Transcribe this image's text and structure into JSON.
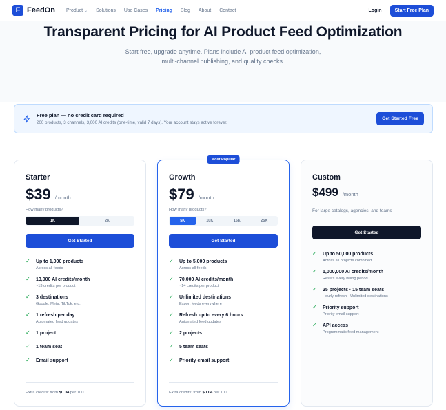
{
  "brand": {
    "name": "FeedOn",
    "mark": "F"
  },
  "nav": {
    "items": [
      {
        "label": "Product",
        "has_menu": true
      },
      {
        "label": "Solutions"
      },
      {
        "label": "Use Cases"
      },
      {
        "label": "Pricing",
        "active": true
      },
      {
        "label": "Blog"
      },
      {
        "label": "About"
      },
      {
        "label": "Contact"
      }
    ],
    "login_label": "Login",
    "cta_label": "Start Free Plan"
  },
  "hero": {
    "title": "Transparent Pricing for AI Product Feed Optimization",
    "subtitle_line1": "Start free, upgrade anytime. Plans include AI product feed optimization,",
    "subtitle_line2": "multi-channel publishing, and quality checks."
  },
  "free_banner": {
    "title": "Free plan — no credit card required",
    "subtitle": "200 products, 3 channels, 3,000 AI credits (one-time, valid 7 days). Your account stays active forever.",
    "button_label": "Get Started Free",
    "icon": "bolt-icon"
  },
  "plans": [
    {
      "name": "Starter",
      "price": "$39",
      "period": "/month",
      "qty_label": "How many products?",
      "options": [
        "1K",
        "2K"
      ],
      "selected": "1K",
      "cta": "Get Started",
      "features": [
        {
          "title": "Up to 1,000 products",
          "sub": "Across all feeds"
        },
        {
          "title": "13,000 AI credits/month",
          "sub": "~13 credits per product"
        },
        {
          "title": "3 destinations",
          "sub": "Google, Meta, TikTok, etc."
        },
        {
          "title": "1 refresh per day",
          "sub": "Automated feed updates"
        },
        {
          "title": "1 project",
          "sub": ""
        },
        {
          "title": "1 team seat",
          "sub": ""
        },
        {
          "title": "Email support",
          "sub": ""
        }
      ],
      "extra_prefix": "Extra credits: from",
      "extra_price": "$0.04",
      "extra_suffix": "per 100"
    },
    {
      "name": "Growth",
      "badge": "Most Popular",
      "price": "$79",
      "period": "/month",
      "qty_label": "How many products?",
      "options": [
        "5K",
        "10K",
        "15K",
        "25K"
      ],
      "selected": "5K",
      "cta": "Get Started",
      "features": [
        {
          "title": "Up to 5,000 products",
          "sub": "Across all feeds"
        },
        {
          "title": "70,000 AI credits/month",
          "sub": "~14 credits per product"
        },
        {
          "title": "Unlimited destinations",
          "sub": "Export feeds everywhere"
        },
        {
          "title": "Refresh up to every 6 hours",
          "sub": "Automated feed updates"
        },
        {
          "title": "2 projects",
          "sub": ""
        },
        {
          "title": "5 team seats",
          "sub": ""
        },
        {
          "title": "Priority email support",
          "sub": ""
        }
      ],
      "extra_prefix": "Extra credits: from",
      "extra_price": "$0.04",
      "extra_suffix": "per 100"
    },
    {
      "name": "Custom",
      "price": "$499",
      "period": "/month",
      "description": "For large catalogs, agencies, and teams",
      "cta": "Get Started",
      "features": [
        {
          "title": "Up to 50,000 products",
          "sub": "Across all projects combined"
        },
        {
          "title": "1,000,000 AI credits/month",
          "sub": "Resets every billing period"
        },
        {
          "title": "25 projects · 15 team seats",
          "sub": "Hourly refresh · Unlimited destinations"
        },
        {
          "title": "Priority support",
          "sub": "Priority email support"
        },
        {
          "title": "API access",
          "sub": "Programmatic feed management"
        }
      ]
    }
  ],
  "colors": {
    "primary": "#1d4ed8",
    "dark": "#0f172a",
    "check": "#16a34a",
    "muted": "#64748b"
  }
}
